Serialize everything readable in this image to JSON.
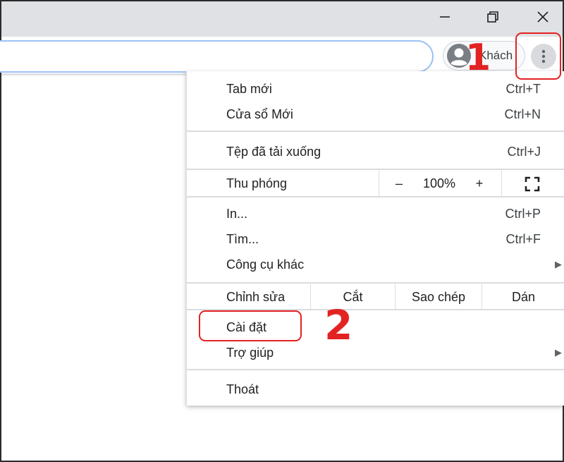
{
  "window": {
    "minimize_icon": "minimize-icon",
    "maximize_icon": "restore-icon",
    "close_icon": "close-icon"
  },
  "toolbar": {
    "profile_label": "Khách",
    "menu_icon": "three-dot-vertical-icon"
  },
  "menu": {
    "new_tab": {
      "label": "Tab mới",
      "shortcut": "Ctrl+T"
    },
    "new_window": {
      "label": "Cửa sổ Mới",
      "shortcut": "Ctrl+N"
    },
    "downloads": {
      "label": "Tệp đã tải xuống",
      "shortcut": "Ctrl+J"
    },
    "zoom": {
      "label": "Thu phóng",
      "minus": "–",
      "value": "100%",
      "plus": "+",
      "fullscreen_icon": "fullscreen-icon"
    },
    "print": {
      "label": "In...",
      "shortcut": "Ctrl+P"
    },
    "find": {
      "label": "Tìm...",
      "shortcut": "Ctrl+F"
    },
    "more_tools": {
      "label": "Công cụ khác"
    },
    "edit": {
      "label": "Chỉnh sửa",
      "cut": "Cắt",
      "copy": "Sao chép",
      "paste": "Dán"
    },
    "settings": {
      "label": "Cài đặt"
    },
    "help": {
      "label": "Trợ giúp"
    },
    "exit": {
      "label": "Thoát"
    }
  },
  "annotations": {
    "step1": "1",
    "step2": "2",
    "color": "#e32222"
  }
}
